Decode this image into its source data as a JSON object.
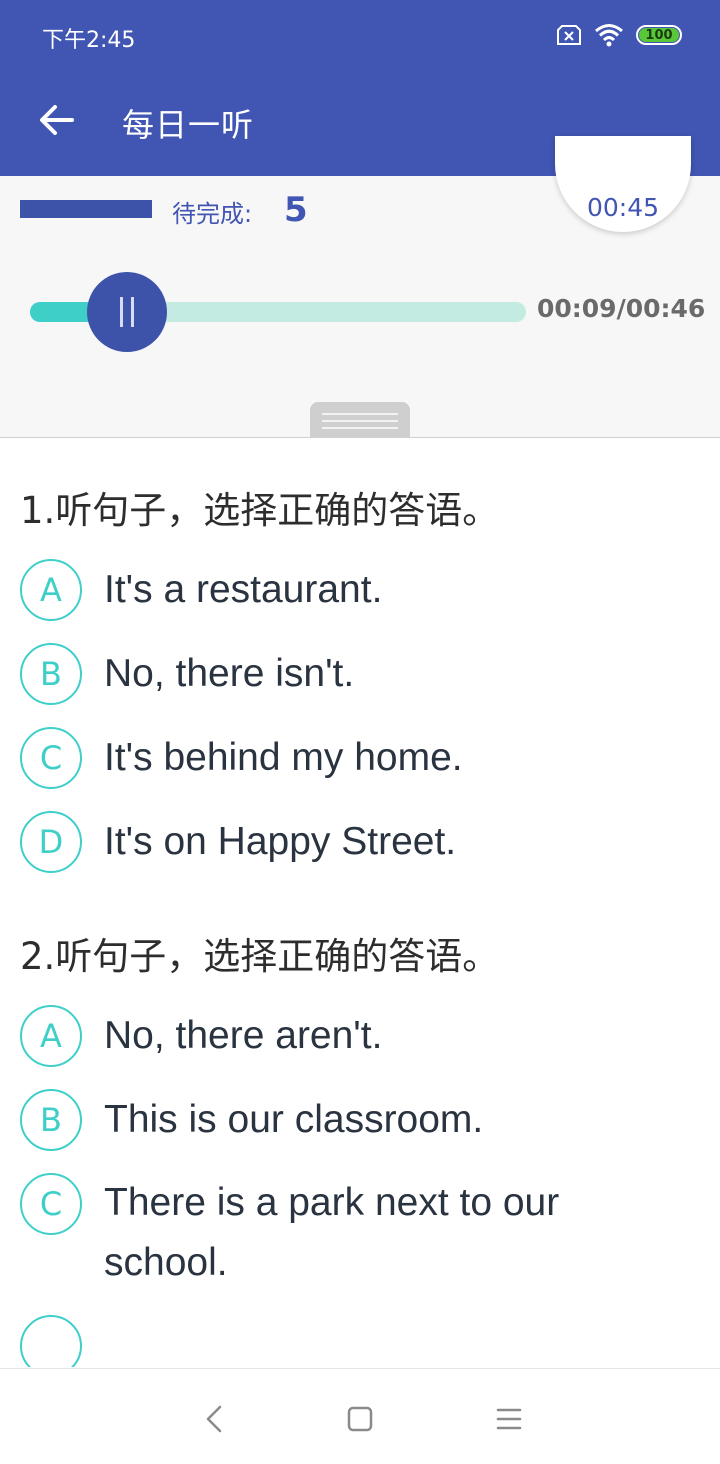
{
  "status_bar": {
    "time": "下午2:45",
    "battery": "100",
    "icons": [
      "sim-off-icon",
      "wifi-icon",
      "battery-icon"
    ]
  },
  "header": {
    "title": "每日一听",
    "back_icon": "arrow-left-icon"
  },
  "player": {
    "pending_label": "待完成:",
    "pending_count": "5",
    "countdown": "00:45",
    "time_readout": "00:09/00:46",
    "progress": 0.196,
    "playing": true
  },
  "questions": [
    {
      "title": "1.听句子，选择正确的答语。",
      "options": [
        {
          "letter": "A",
          "text": "It's a restaurant."
        },
        {
          "letter": "B",
          "text": "No, there isn't."
        },
        {
          "letter": "C",
          "text": "It's behind my home."
        },
        {
          "letter": "D",
          "text": "It's on Happy Street."
        }
      ]
    },
    {
      "title": "2.听句子，选择正确的答语。",
      "options": [
        {
          "letter": "A",
          "text": "No, there aren't."
        },
        {
          "letter": "B",
          "text": "This is our classroom."
        },
        {
          "letter": "C",
          "text": "There is a park next to our school."
        }
      ]
    }
  ],
  "nav_bar": {
    "icons": [
      "back-nav-icon",
      "home-nav-icon",
      "menu-nav-icon"
    ]
  },
  "colors": {
    "primary": "#4155b2",
    "accent": "#3ecfc9",
    "track": "#c4ebe1",
    "text": "#2a3340"
  }
}
